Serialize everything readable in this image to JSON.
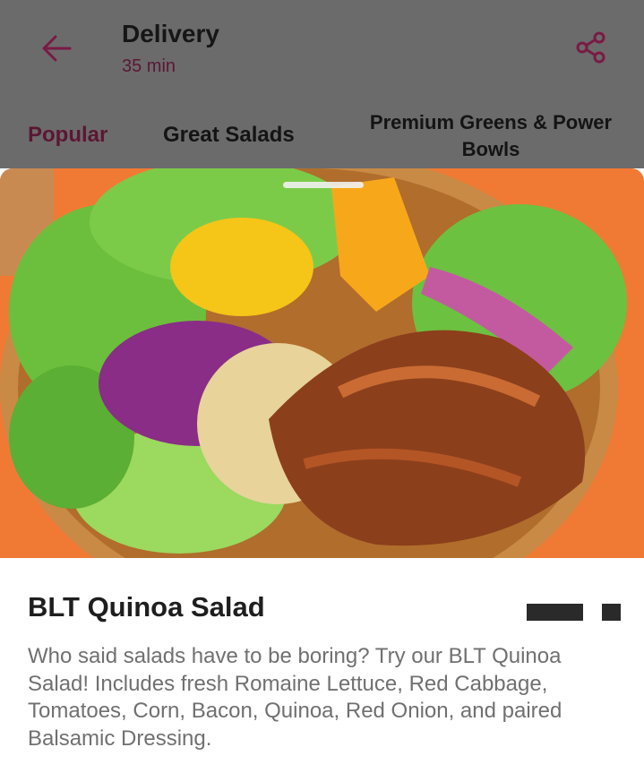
{
  "header": {
    "title": "Delivery",
    "subtitle": "35 min",
    "back_icon": "arrow-left-icon",
    "share_icon": "share-icon",
    "accent_color": "#8a1d4d"
  },
  "tabs": [
    {
      "label": "Popular",
      "active": true
    },
    {
      "label": "Great Salads",
      "active": false
    },
    {
      "label": "Premium Greens & Power Bowls",
      "active": false
    }
  ],
  "item": {
    "name": "BLT Quinoa Salad",
    "description": "Who said salads have to be boring? Try our BLT Quinoa Salad! Includes fresh Romaine Lettuce, Red Cabbage, Tomatoes, Corn, Bacon, Quinoa, Red Onion, and paired Balsamic Dressing."
  }
}
